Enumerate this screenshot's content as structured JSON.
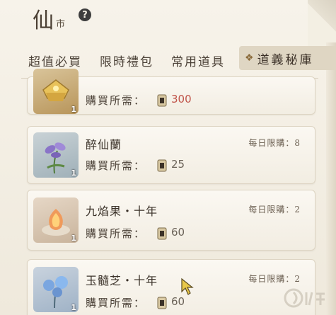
{
  "header": {
    "title_main": "仙",
    "title_sub": "市",
    "help_glyph": "?"
  },
  "tabs": [
    {
      "label": "超值必買"
    },
    {
      "label": "限時禮包"
    },
    {
      "label": "常用道具"
    },
    {
      "label": "道義秘庫",
      "active": true,
      "icon": "diamond-icon"
    }
  ],
  "items": [
    {
      "name": "",
      "limit": "",
      "cost_label": "購買所需：",
      "cost": "300",
      "count": "1",
      "cost_color": "#c0544a",
      "icon": "gold-treasure-icon"
    },
    {
      "name": "醉仙蘭",
      "limit": "每日限購：8",
      "cost_label": "購買所需：",
      "cost": "25",
      "count": "1",
      "cost_color": "#6a6258",
      "icon": "purple-orchid-icon"
    },
    {
      "name": "九焰果・十年",
      "limit": "每日限購：2",
      "cost_label": "購買所需：",
      "cost": "60",
      "count": "1",
      "cost_color": "#6a6258",
      "icon": "flame-fruit-icon"
    },
    {
      "name": "玉髓芝・十年",
      "limit": "每日限購：2",
      "cost_label": "購買所需：",
      "cost": "60",
      "count": "1",
      "cost_color": "#6a6258",
      "icon": "blue-lingzhi-icon"
    }
  ],
  "colors": {
    "accent_tab": "#dfd6c3",
    "price_red": "#c0544a",
    "background": "#f3efe3"
  }
}
